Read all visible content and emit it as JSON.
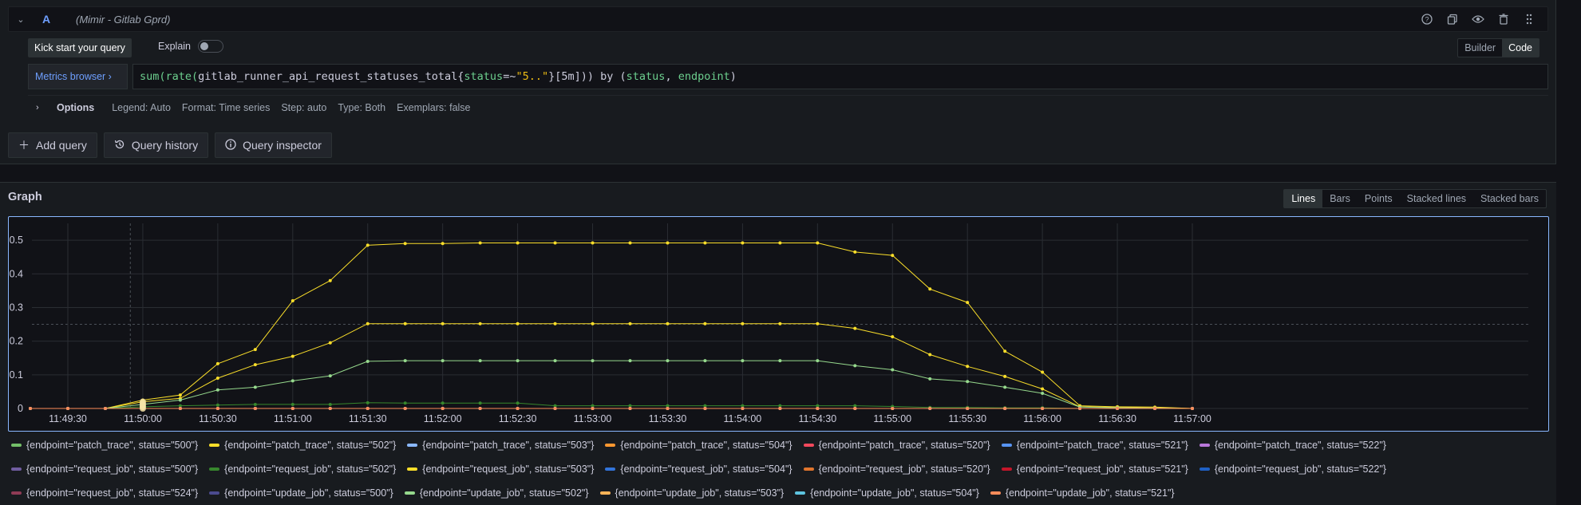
{
  "query": {
    "letter": "A",
    "datasource": "(Mimir - Gitlab Gprd)",
    "kick_start": "Kick start your query",
    "explain": "Explain",
    "modes": [
      "Builder",
      "Code"
    ],
    "active_mode": "Code",
    "metrics_browser": "Metrics browser ›",
    "expr_parts": [
      {
        "t": "sum(",
        "c": "fn"
      },
      {
        "t": "rate(",
        "c": "fn"
      },
      {
        "t": "gitlab_runner_api_request_statuses_total{",
        "c": "m"
      },
      {
        "t": "status",
        "c": "key"
      },
      {
        "t": "=~",
        "c": "m"
      },
      {
        "t": "\"5..\"",
        "c": "str"
      },
      {
        "t": "}[5m])) ",
        "c": "m"
      },
      {
        "t": "by",
        "c": "m"
      },
      {
        "t": " (",
        "c": "m"
      },
      {
        "t": "status",
        "c": "key"
      },
      {
        "t": ", ",
        "c": "m"
      },
      {
        "t": "endpoint",
        "c": "key"
      },
      {
        "t": ")",
        "c": "m"
      }
    ],
    "options_label": "Options",
    "options": [
      "Legend: Auto",
      "Format: Time series",
      "Step: auto",
      "Type: Both",
      "Exemplars: false"
    ]
  },
  "buttons": {
    "add_query": "Add query",
    "query_history": "Query history",
    "query_inspector": "Query inspector"
  },
  "graph": {
    "title": "Graph",
    "view_types": [
      "Lines",
      "Bars",
      "Points",
      "Stacked lines",
      "Stacked bars"
    ],
    "active_view": "Lines"
  },
  "chart_data": {
    "type": "line",
    "x": [
      "11:49:30",
      "11:50:00",
      "11:50:30",
      "11:51:00",
      "11:51:30",
      "11:52:00",
      "11:52:30",
      "11:53:00",
      "11:53:30",
      "11:54:00",
      "11:54:30",
      "11:55:00",
      "11:55:30",
      "11:56:00",
      "11:56:30",
      "11:57:00"
    ],
    "x_time_seconds_from_first_tick": [
      0,
      30,
      60,
      90,
      120,
      150,
      180,
      210,
      240,
      270,
      300,
      330,
      360,
      390,
      420,
      450
    ],
    "ylim": [
      0,
      0.55
    ],
    "yticks": [
      0,
      0.1,
      0.2,
      0.3,
      0.4,
      0.5
    ],
    "ytick_labels": [
      "0",
      "0.1",
      "0.2",
      "0.3",
      "0.4",
      "0.5"
    ],
    "grid": true,
    "legend_placement": "bottom",
    "sample_times_s": [
      -15,
      0,
      15,
      30,
      45,
      60,
      75,
      90,
      105,
      120,
      135,
      150,
      165,
      180,
      195,
      210,
      225,
      240,
      255,
      270,
      285,
      300,
      315,
      330,
      345,
      360,
      375,
      390,
      405,
      420,
      435,
      450
    ],
    "series": [
      {
        "name": "{endpoint=\"patch_trace\", status=\"500\"}",
        "color": "#73bf69",
        "values": [
          0,
          0,
          0,
          0,
          0,
          0,
          0,
          0,
          0,
          0,
          0,
          0,
          0,
          0,
          0,
          0,
          0,
          0,
          0,
          0,
          0,
          0,
          0,
          0,
          0,
          0,
          0,
          0,
          0,
          0,
          0,
          0
        ]
      },
      {
        "name": "{endpoint=\"patch_trace\", status=\"502\"}",
        "color": "#fade2a",
        "values": [
          0,
          0,
          0,
          0.02,
          0.03,
          0.09,
          0.13,
          0.155,
          0.195,
          0.252,
          0.252,
          0.252,
          0.252,
          0.252,
          0.252,
          0.252,
          0.252,
          0.252,
          0.252,
          0.252,
          0.252,
          0.252,
          0.238,
          0.213,
          0.16,
          0.125,
          0.095,
          0.058,
          0.005,
          0.003,
          0.002,
          0
        ]
      },
      {
        "name": "{endpoint=\"patch_trace\", status=\"503\"}",
        "color": "#8ab8ff",
        "values": [
          0,
          0,
          0,
          0,
          0,
          0,
          0,
          0,
          0,
          0,
          0,
          0,
          0,
          0,
          0,
          0,
          0,
          0,
          0,
          0,
          0,
          0,
          0,
          0,
          0,
          0,
          0,
          0,
          0,
          0,
          0,
          0
        ]
      },
      {
        "name": "{endpoint=\"patch_trace\", status=\"504\"}",
        "color": "#ff9830",
        "values": [
          0,
          0,
          0,
          0,
          0,
          0,
          0,
          0,
          0,
          0,
          0,
          0,
          0,
          0,
          0,
          0,
          0,
          0,
          0,
          0,
          0,
          0,
          0,
          0,
          0,
          0,
          0,
          0,
          0,
          0,
          0,
          0
        ]
      },
      {
        "name": "{endpoint=\"patch_trace\", status=\"520\"}",
        "color": "#f2495c",
        "values": [
          0,
          0,
          0,
          0,
          0,
          0,
          0,
          0,
          0,
          0,
          0,
          0,
          0,
          0,
          0,
          0,
          0,
          0,
          0,
          0,
          0,
          0,
          0,
          0,
          0,
          0,
          0,
          0,
          0,
          0,
          0,
          0
        ]
      },
      {
        "name": "{endpoint=\"patch_trace\", status=\"521\"}",
        "color": "#5794f2",
        "values": [
          0,
          0,
          0,
          0,
          0,
          0,
          0,
          0,
          0,
          0,
          0,
          0,
          0,
          0,
          0,
          0,
          0,
          0,
          0,
          0,
          0,
          0,
          0,
          0,
          0,
          0,
          0,
          0,
          0,
          0,
          0,
          0
        ]
      },
      {
        "name": "{endpoint=\"patch_trace\", status=\"522\"}",
        "color": "#b877d9",
        "values": [
          0,
          0,
          0,
          0,
          0,
          0,
          0,
          0,
          0,
          0,
          0,
          0,
          0,
          0,
          0,
          0,
          0,
          0,
          0,
          0,
          0,
          0,
          0,
          0,
          0,
          0,
          0,
          0,
          0,
          0,
          0,
          0
        ]
      },
      {
        "name": "{endpoint=\"request_job\", status=\"500\"}",
        "color": "#705da0",
        "values": [
          0,
          0,
          0,
          0,
          0,
          0,
          0,
          0,
          0,
          0,
          0,
          0,
          0,
          0,
          0,
          0,
          0,
          0,
          0,
          0,
          0,
          0,
          0,
          0,
          0,
          0,
          0,
          0,
          0,
          0,
          0,
          0
        ]
      },
      {
        "name": "{endpoint=\"request_job\", status=\"502\"}",
        "color": "#37872d",
        "values": [
          0,
          0,
          0,
          0.005,
          0.008,
          0.01,
          0.012,
          0.012,
          0.012,
          0.017,
          0.016,
          0.016,
          0.016,
          0.016,
          0.008,
          0.008,
          0.008,
          0.008,
          0.008,
          0.008,
          0.008,
          0.008,
          0.008,
          0.006,
          0.003,
          0.003,
          0.002,
          0.002,
          0,
          0,
          0,
          0
        ]
      },
      {
        "name": "{endpoint=\"request_job\", status=\"503\"}",
        "color": "#fade2a",
        "values": [
          0,
          0,
          0,
          0.025,
          0.04,
          0.133,
          0.175,
          0.32,
          0.38,
          0.485,
          0.49,
          0.49,
          0.492,
          0.492,
          0.492,
          0.492,
          0.492,
          0.492,
          0.492,
          0.492,
          0.492,
          0.492,
          0.465,
          0.455,
          0.355,
          0.315,
          0.17,
          0.108,
          0.008,
          0.005,
          0.004,
          0
        ]
      },
      {
        "name": "{endpoint=\"request_job\", status=\"504\"}",
        "color": "#3274d9",
        "values": [
          0,
          0,
          0,
          0,
          0,
          0,
          0,
          0,
          0,
          0,
          0,
          0,
          0,
          0,
          0,
          0,
          0,
          0,
          0,
          0,
          0,
          0,
          0,
          0,
          0,
          0,
          0,
          0,
          0,
          0,
          0,
          0
        ]
      },
      {
        "name": "{endpoint=\"request_job\", status=\"520\"}",
        "color": "#e0752d",
        "values": [
          0,
          0,
          0,
          0,
          0,
          0,
          0,
          0,
          0,
          0,
          0,
          0,
          0,
          0,
          0,
          0,
          0,
          0,
          0,
          0,
          0,
          0,
          0,
          0,
          0,
          0,
          0,
          0,
          0,
          0,
          0,
          0
        ]
      },
      {
        "name": "{endpoint=\"request_job\", status=\"521\"}",
        "color": "#c4162a",
        "values": [
          0,
          0,
          0,
          0,
          0,
          0,
          0,
          0,
          0,
          0,
          0,
          0,
          0,
          0,
          0,
          0,
          0,
          0,
          0,
          0,
          0,
          0,
          0,
          0,
          0,
          0,
          0,
          0,
          0,
          0,
          0,
          0
        ]
      },
      {
        "name": "{endpoint=\"request_job\", status=\"522\"}",
        "color": "#1f60c4",
        "values": [
          0,
          0,
          0,
          0,
          0,
          0,
          0,
          0,
          0,
          0,
          0,
          0,
          0,
          0,
          0,
          0,
          0,
          0,
          0,
          0,
          0,
          0,
          0,
          0,
          0,
          0,
          0,
          0,
          0,
          0,
          0,
          0
        ]
      },
      {
        "name": "{endpoint=\"request_job\", status=\"524\"}",
        "color": "#8f3b55",
        "values": [
          0,
          0,
          0,
          0,
          0,
          0,
          0,
          0,
          0,
          0,
          0,
          0,
          0,
          0,
          0,
          0,
          0,
          0,
          0,
          0,
          0,
          0,
          0,
          0,
          0,
          0,
          0,
          0,
          0,
          0,
          0,
          0
        ]
      },
      {
        "name": "{endpoint=\"update_job\", status=\"500\"}",
        "color": "#4b4b8f",
        "values": [
          0,
          0,
          0,
          0,
          0,
          0,
          0,
          0,
          0,
          0,
          0,
          0,
          0,
          0,
          0,
          0,
          0,
          0,
          0,
          0,
          0,
          0,
          0,
          0,
          0,
          0,
          0,
          0,
          0,
          0,
          0,
          0
        ]
      },
      {
        "name": "{endpoint=\"update_job\", status=\"502\"}",
        "color": "#96d98d",
        "values": [
          0,
          0,
          0,
          0.012,
          0.025,
          0.055,
          0.063,
          0.082,
          0.097,
          0.14,
          0.142,
          0.142,
          0.142,
          0.142,
          0.142,
          0.142,
          0.142,
          0.142,
          0.142,
          0.142,
          0.142,
          0.142,
          0.127,
          0.115,
          0.088,
          0.08,
          0.063,
          0.045,
          0.004,
          0.002,
          0.001,
          0
        ]
      },
      {
        "name": "{endpoint=\"update_job\", status=\"503\"}",
        "color": "#ffb357",
        "values": [
          0,
          0,
          0,
          0,
          0,
          0,
          0,
          0,
          0,
          0,
          0,
          0,
          0,
          0,
          0,
          0,
          0,
          0,
          0,
          0,
          0,
          0,
          0,
          0,
          0,
          0,
          0,
          0,
          0,
          0,
          0,
          0
        ]
      },
      {
        "name": "{endpoint=\"update_job\", status=\"504\"}",
        "color": "#5ec4e0",
        "values": [
          0,
          0,
          0,
          0,
          0,
          0,
          0,
          0,
          0,
          0,
          0,
          0,
          0,
          0,
          0,
          0,
          0,
          0,
          0,
          0,
          0,
          0,
          0,
          0,
          0,
          0,
          0,
          0,
          0,
          0,
          0,
          0
        ]
      },
      {
        "name": "{endpoint=\"update_job\", status=\"521\"}",
        "color": "#ff8c5a",
        "values": [
          0,
          0,
          0,
          0,
          0,
          0,
          0,
          0,
          0,
          0,
          0,
          0,
          0,
          0,
          0,
          0,
          0,
          0,
          0,
          0,
          0,
          0,
          0,
          0,
          0,
          0,
          0,
          0,
          0,
          0,
          0,
          0
        ]
      }
    ]
  }
}
